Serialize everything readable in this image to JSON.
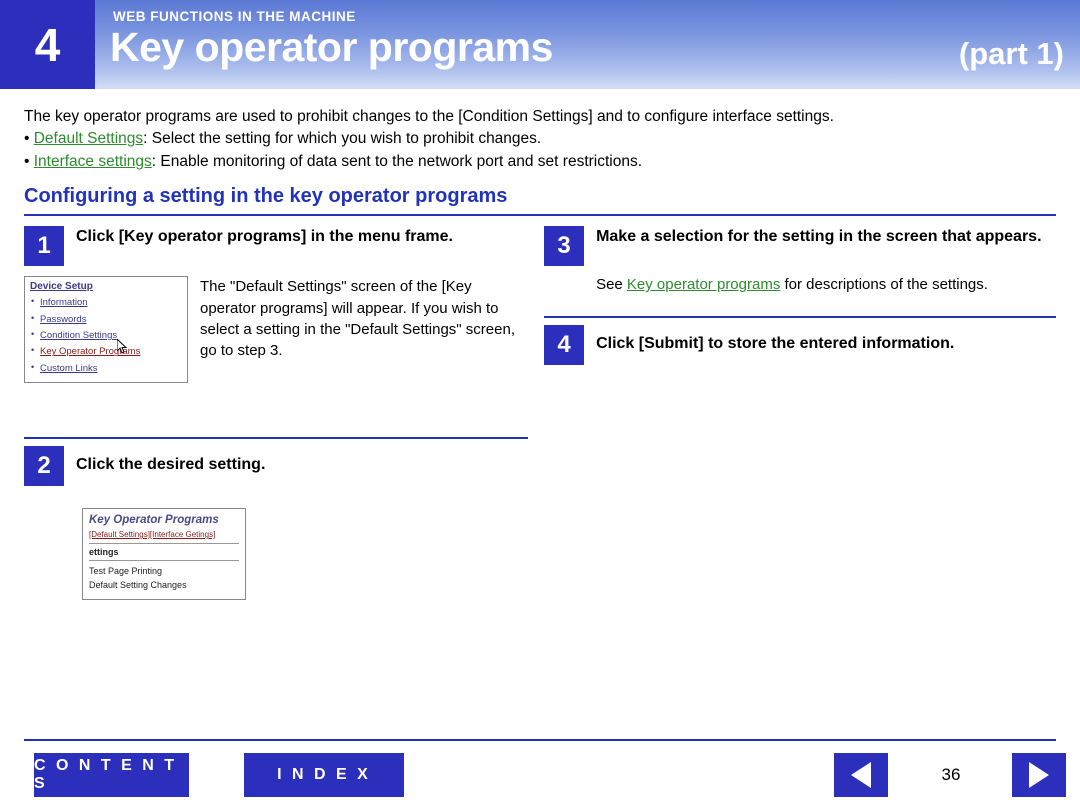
{
  "header": {
    "chapter_number": "4",
    "kicker": "WEB FUNCTIONS IN THE MACHINE",
    "title": "Key operator programs",
    "part": "(part 1)",
    "accent_color": "#2b2fbb"
  },
  "intro": {
    "paragraph": "The key operator programs are used to prohibit changes to the [Condition Settings] and to configure interface settings.",
    "bullets": [
      {
        "link": "Default Settings",
        "rest": ": Select the setting for which you wish to prohibit changes."
      },
      {
        "link": "Interface settings",
        "rest": ": Enable monitoring of data sent to the network port and set restrictions."
      }
    ]
  },
  "section": {
    "title": "Configuring a setting in the key operator programs"
  },
  "steps": [
    {
      "number": "1",
      "title": "Click [Key operator programs] in the menu frame.",
      "body": "The \"Default Settings\" screen of the [Key operator programs] will appear. If you wish to select a setting in the \"Default Settings\" screen, go to step 3."
    },
    {
      "number": "2",
      "title": "Click the desired setting."
    },
    {
      "number": "3",
      "title": "Make a selection for the setting in the screen that appears.",
      "body_prefix": "See ",
      "body_link": "Key operator programs",
      "body_suffix": " for descriptions of the settings."
    },
    {
      "number": "4",
      "title": "Click [Submit] to store the entered information."
    }
  ],
  "figure_menu": {
    "title": "Device Setup",
    "items": [
      {
        "label": "Information",
        "selected": false
      },
      {
        "label": "Passwords",
        "selected": false
      },
      {
        "label": "Condition Settings",
        "selected": false
      },
      {
        "label": "Key Operator Programs",
        "selected": true
      },
      {
        "label": "Custom Links",
        "selected": false
      }
    ],
    "cursor_icon": "mouse-pointer-icon"
  },
  "figure_kop": {
    "title": "Key Operator Programs",
    "links": [
      "[Default Settings]",
      "[Interface Getings]"
    ],
    "bar_label": "ettings",
    "items": [
      "Test Page Printing",
      "Default Setting Changes"
    ]
  },
  "footer": {
    "contents_label": "C O N T E N T S",
    "index_label": "I N D E X",
    "page_number": "36",
    "prev_icon": "triangle-left-icon",
    "next_icon": "triangle-right-icon"
  }
}
